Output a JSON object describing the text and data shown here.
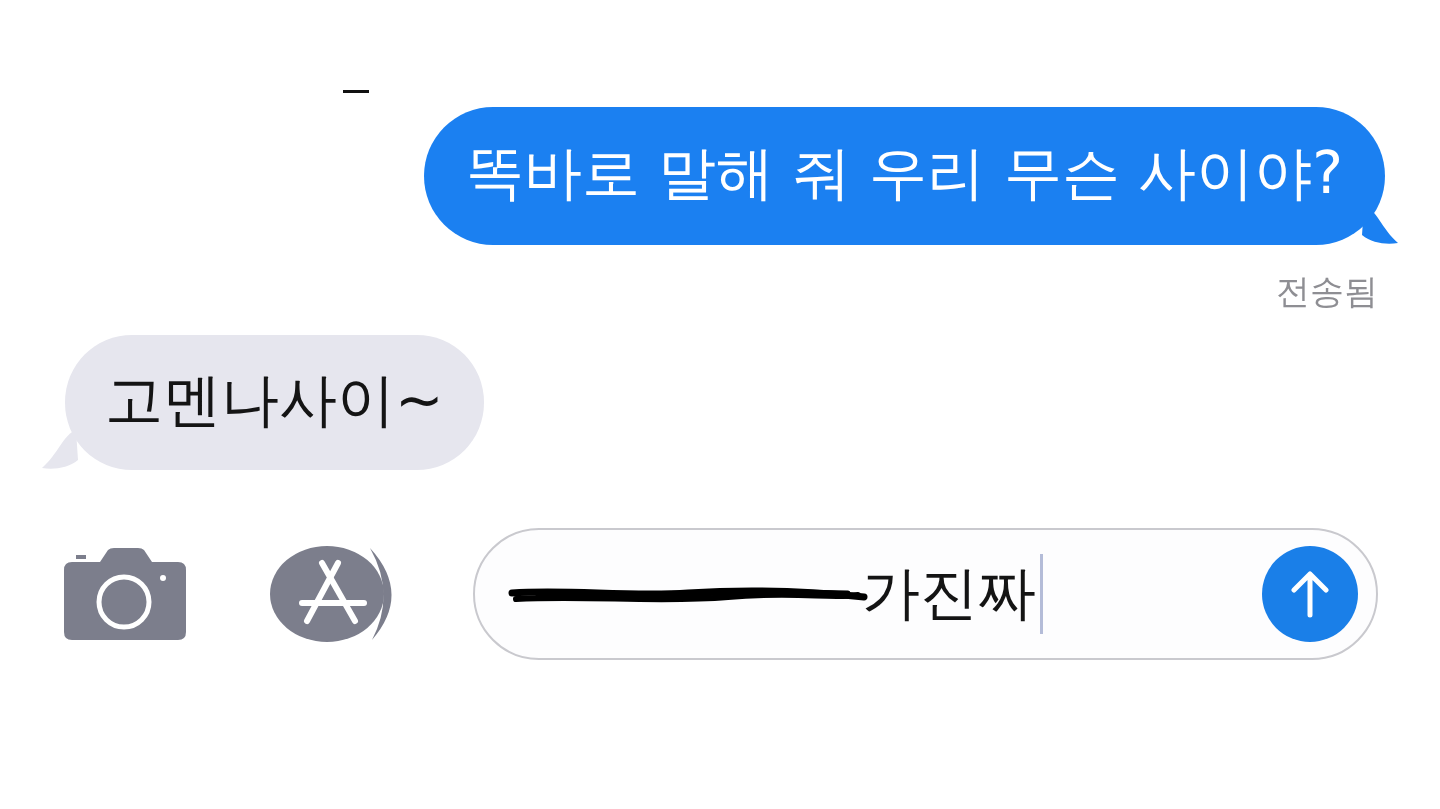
{
  "messages": [
    {
      "kind": "sent",
      "text": "똑바로 말해 줘 우리 무슨 사이야?",
      "status": "전송됨"
    },
    {
      "kind": "received",
      "text": "고멘나사이~"
    }
  ],
  "composer": {
    "value": "가진짜",
    "scribbled_out": true
  }
}
